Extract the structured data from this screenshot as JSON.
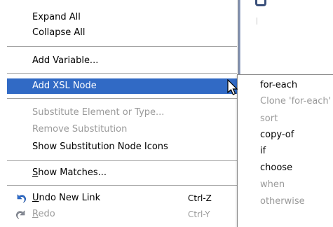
{
  "menu": {
    "expand_all": "Expand All",
    "collapse_all": "Collapse All",
    "add_variable": "Add Variable...",
    "add_xsl_node": "Add XSL Node",
    "substitute_element": "Substitute Element or Type...",
    "remove_substitution": "Remove Substitution",
    "show_substitution_icons": "Show Substitution Node Icons",
    "show_matches_prefix": "S",
    "show_matches_rest": "how Matches...",
    "undo_prefix": "U",
    "undo_rest": "ndo New Link",
    "undo_shortcut": "Ctrl-Z",
    "redo_prefix": "R",
    "redo_rest": "edo",
    "redo_shortcut": "Ctrl-Y"
  },
  "submenu": {
    "items": [
      {
        "label": "for-each",
        "disabled": false
      },
      {
        "label": "Clone 'for-each'",
        "disabled": true
      },
      {
        "label": "sort",
        "disabled": true
      },
      {
        "label": "copy-of",
        "disabled": false
      },
      {
        "label": "if",
        "disabled": false
      },
      {
        "label": "choose",
        "disabled": false
      },
      {
        "label": "when",
        "disabled": true
      },
      {
        "label": "otherwise",
        "disabled": true
      }
    ]
  },
  "icons": {
    "undo": "undo-arrow-icon",
    "redo": "redo-arrow-icon",
    "cursor": "mouse-pointer-icon"
  },
  "colors": {
    "selection": "#316ac5",
    "disabled_text": "#9a9a9a",
    "undo_icon": "#2f6fd0",
    "redo_icon": "#8a8f9a"
  }
}
